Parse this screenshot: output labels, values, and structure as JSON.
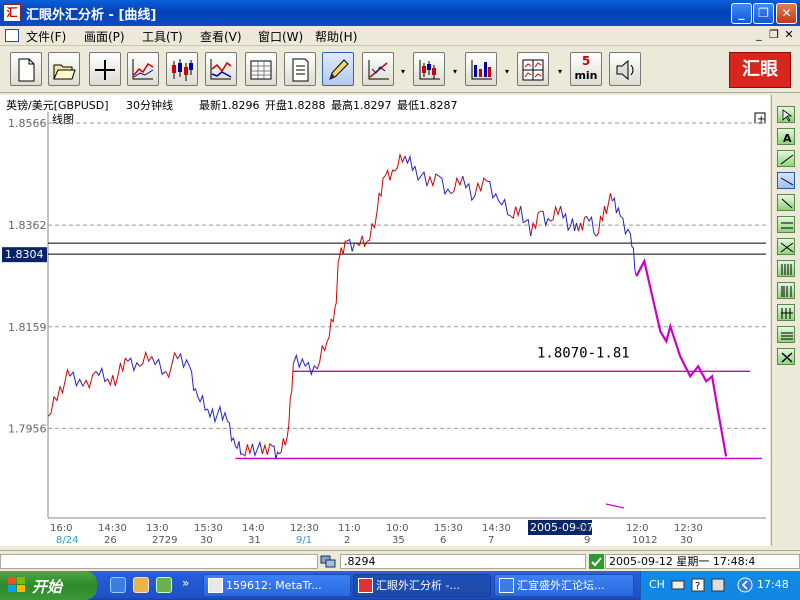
{
  "window": {
    "title": "汇眼外汇分析 - [曲线]",
    "minimize": "_",
    "restore": "❐",
    "close": "✕",
    "icon_letter": "汇"
  },
  "menu": {
    "items": [
      "文件(F)",
      "画面(P)",
      "工具(T)",
      "查看(V)",
      "窗口(W)",
      "帮助(H)"
    ],
    "mdi_minimize": "_",
    "mdi_restore": "❐",
    "mdi_close": "✕"
  },
  "toolbar": {
    "buttons": [
      "new-document",
      "open-folder",
      "crosshair",
      "line-chart",
      "candlestick-chart",
      "compare-chart",
      "table-view",
      "notes",
      "pencil-draw",
      "trend-tools",
      "bar-chart",
      "volume-chart",
      "multi-chart",
      "five-min",
      "sound"
    ],
    "five_top": "5",
    "five_bottom": "min",
    "drop_arrow": "▾",
    "logo": "汇眼"
  },
  "info": {
    "pair": "英镑/美元[GBPUSD]",
    "period": "30分钟线",
    "latest": "最新1.8296",
    "open": "开盘1.8288",
    "high": "最高1.8297",
    "low": "最低1.8287"
  },
  "chart_data": {
    "type": "line",
    "title": "线图",
    "y_ticks": [
      "1.8566",
      "1.8362",
      "1.8159",
      "1.7956"
    ],
    "ylim": [
      1.7777,
      1.8588
    ],
    "current_price_label": "1.8304",
    "current_price": 1.8304,
    "hline_upper": 1.8326,
    "annotation": "1.8070-1.81",
    "magenta_levels": [
      1.807,
      1.7896
    ],
    "x_ticks": [
      "16:0",
      "14:30",
      "13:0",
      "15:30",
      "14:0",
      "12:30",
      "11:0",
      "10:0",
      "15:30",
      "14:30",
      "2005-09-07",
      "30",
      "12:0",
      "12:30"
    ],
    "x_sub": [
      "8/24",
      "26",
      "2729",
      "30",
      "31",
      "9/1",
      "2",
      "35",
      "6",
      "7",
      "",
      "9",
      "1012",
      "30"
    ],
    "price_series": [
      [
        0,
        1.798
      ],
      [
        12,
        1.804
      ],
      [
        22,
        1.806
      ],
      [
        35,
        1.804
      ],
      [
        48,
        1.807
      ],
      [
        60,
        1.8055
      ],
      [
        70,
        1.806
      ],
      [
        80,
        1.809
      ],
      [
        92,
        1.808
      ],
      [
        104,
        1.81
      ],
      [
        118,
        1.807
      ],
      [
        130,
        1.8095
      ],
      [
        142,
        1.808
      ],
      [
        150,
        1.802
      ],
      [
        160,
        1.7995
      ],
      [
        170,
        1.7985
      ],
      [
        180,
        1.797
      ],
      [
        188,
        1.792
      ],
      [
        195,
        1.7905
      ],
      [
        205,
        1.7925
      ],
      [
        215,
        1.7905
      ],
      [
        225,
        1.792
      ],
      [
        232,
        1.7905
      ],
      [
        240,
        1.794
      ],
      [
        246,
        1.8085
      ],
      [
        258,
        1.808
      ],
      [
        270,
        1.8075
      ],
      [
        280,
        1.813
      ],
      [
        288,
        1.82
      ],
      [
        292,
        1.8295
      ],
      [
        300,
        1.833
      ],
      [
        310,
        1.8325
      ],
      [
        320,
        1.833
      ],
      [
        330,
        1.839
      ],
      [
        338,
        1.846
      ],
      [
        348,
        1.847
      ],
      [
        358,
        1.85
      ],
      [
        368,
        1.848
      ],
      [
        380,
        1.844
      ],
      [
        392,
        1.846
      ],
      [
        404,
        1.8425
      ],
      [
        416,
        1.846
      ],
      [
        428,
        1.842
      ],
      [
        440,
        1.845
      ],
      [
        452,
        1.841
      ],
      [
        464,
        1.838
      ],
      [
        474,
        1.84
      ],
      [
        484,
        1.834
      ],
      [
        494,
        1.839
      ],
      [
        504,
        1.837
      ],
      [
        514,
        1.84
      ],
      [
        524,
        1.836
      ],
      [
        532,
        1.835
      ],
      [
        540,
        1.838
      ],
      [
        550,
        1.834
      ],
      [
        558,
        1.84
      ],
      [
        566,
        1.841
      ],
      [
        574,
        1.838
      ],
      [
        584,
        1.8345
      ],
      [
        590,
        1.826
      ]
    ],
    "projection": [
      [
        590,
        1.826
      ],
      [
        598,
        1.829
      ],
      [
        606,
        1.822
      ],
      [
        614,
        1.815
      ],
      [
        620,
        1.813
      ],
      [
        624,
        1.816
      ],
      [
        634,
        1.81
      ],
      [
        644,
        1.806
      ],
      [
        652,
        1.808
      ],
      [
        660,
        1.805
      ],
      [
        666,
        1.806
      ],
      [
        672,
        1.799
      ],
      [
        680,
        1.79
      ]
    ]
  },
  "status": {
    "price": ".8294",
    "datetime": "2005-09-12 星期一 17:48:4"
  },
  "taskbar": {
    "start": "开始",
    "more": "»",
    "tasks": [
      "159612: MetaTr...",
      "汇眼外汇分析 -...",
      "汇宜盛外汇论坛..."
    ],
    "lang": "CH",
    "clock": "17:48"
  }
}
